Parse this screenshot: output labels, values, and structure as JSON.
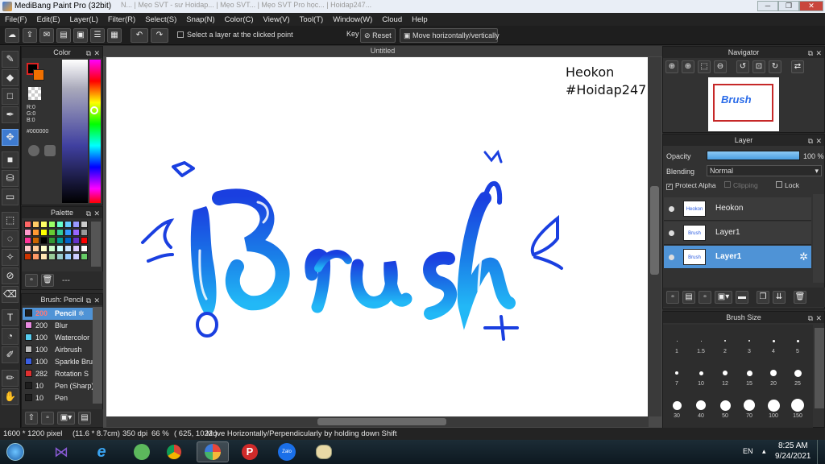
{
  "window": {
    "title": "MediBang Paint Pro (32bit)",
    "bg_tabs_text": "N...   |  Mẹo SVT - sư Hoidap... | Mẹo SVT...  |  Mẹo SVT Pro học... |  Hoidap247... "
  },
  "menu": [
    "File(F)",
    "Edit(E)",
    "Layer(L)",
    "Filter(R)",
    "Select(S)",
    "Snap(N)",
    "Color(C)",
    "View(V)",
    "Tool(T)",
    "Window(W)",
    "Cloud",
    "Help"
  ],
  "toolbar": {
    "select_layer_label": "Select a layer at the clicked point",
    "key_label": "Key",
    "reset_label": "Reset",
    "move_label": "Move horizontally/vertically"
  },
  "color_panel": {
    "title": "Color",
    "r": "R:0",
    "g": "G:0",
    "b": "B:0",
    "hex": "#000000"
  },
  "palette_panel": {
    "title": "Palette",
    "name_field": "---"
  },
  "brush_panel": {
    "title": "Brush: Pencil",
    "items": [
      {
        "size": "200",
        "name": "Pencil",
        "color": "#1e1e1e",
        "selected": true
      },
      {
        "size": "200",
        "name": "Blur",
        "color": "#e98be0"
      },
      {
        "size": "100",
        "name": "Watercolor",
        "color": "#56cdf0"
      },
      {
        "size": "100",
        "name": "Airbrush",
        "color": "#bbbbbb"
      },
      {
        "size": "100",
        "name": "Sparkle Brush",
        "color": "#3a5ee0"
      },
      {
        "size": "282",
        "name": "Rotation S",
        "color": "#e03030"
      },
      {
        "size": "10",
        "name": "Pen (Sharp)",
        "color": "#1e1e1e"
      },
      {
        "size": "10",
        "name": "Pen",
        "color": "#1e1e1e"
      }
    ]
  },
  "document": {
    "tab_title": "Untitled",
    "canvas_text_line1": "Heokon",
    "canvas_text_line2": "#Hoidap247"
  },
  "navigator": {
    "title": "Navigator",
    "thumb_text": "Brush"
  },
  "layer_panel": {
    "title": "Layer",
    "opacity_label": "Opacity",
    "opacity_value": "100 %",
    "opacity_fraction": 1.0,
    "blending_label": "Blending",
    "blending_value": "Normal",
    "protect_alpha_label": "Protect Alpha",
    "clipping_label": "Clipping",
    "lock_label": "Lock",
    "thumb_text": "Heokon",
    "thumb_text2": "Brush",
    "layers": [
      {
        "name": "Heokon",
        "selected": false
      },
      {
        "name": "Layer1",
        "selected": false
      },
      {
        "name": "Layer1",
        "selected": true
      }
    ]
  },
  "brush_size_panel": {
    "title": "Brush Size",
    "sizes": [
      "1",
      "1.5",
      "2",
      "3",
      "4",
      "5",
      "7",
      "10",
      "12",
      "15",
      "20",
      "25",
      "30",
      "40",
      "50",
      "70",
      "100",
      "150"
    ]
  },
  "status": {
    "dimensions": "1600 * 1200 pixel",
    "physical": "(11.6 * 8.7cm)",
    "dpi": "350 dpi",
    "zoom": "66 %",
    "coords": "( 625, 1022 )",
    "hint": "Move Horizontally/Perpendicularly by holding down Shift"
  },
  "taskbar": {
    "lang": "EN",
    "time": "8:25 AM",
    "date": "9/24/2021",
    "zalo_label": "Zalo"
  },
  "colors": {
    "accent": "#4f93d6",
    "ink_blue": "#1a3fe0",
    "ink_cyan": "#22a8f0"
  }
}
